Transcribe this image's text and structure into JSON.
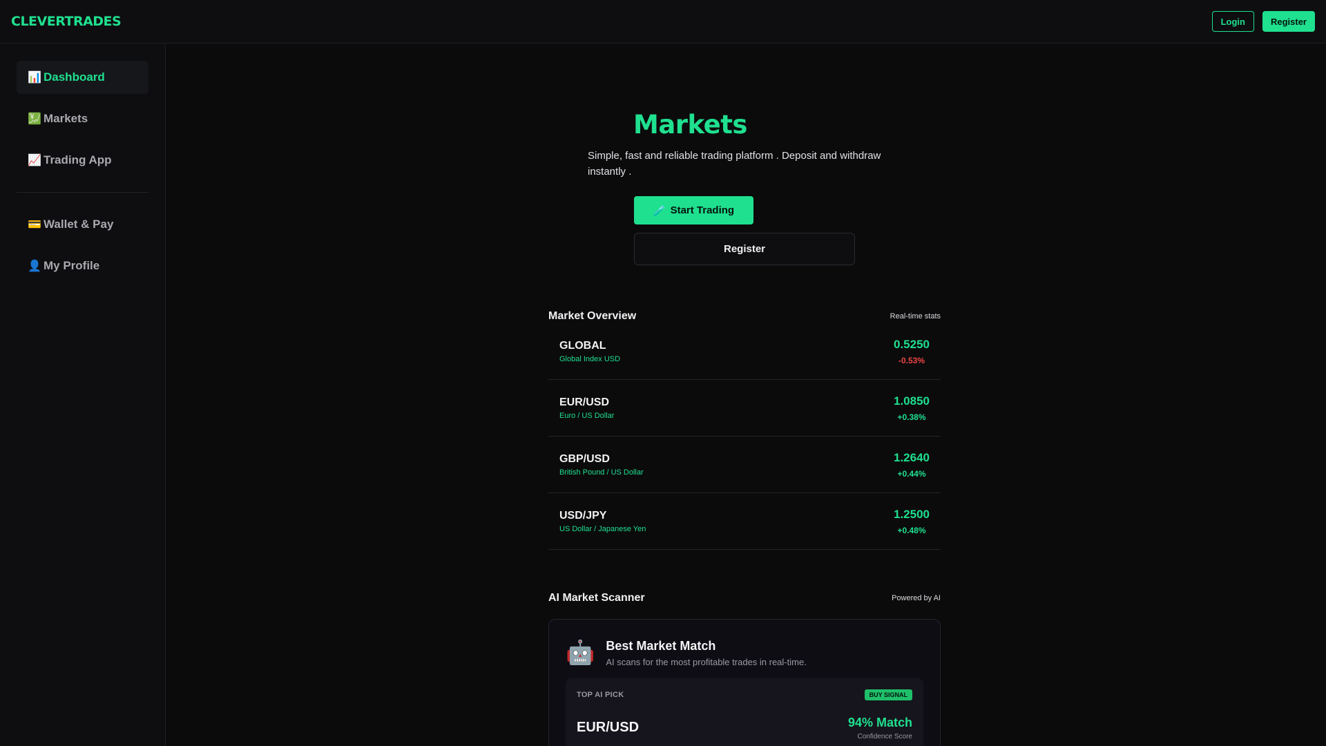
{
  "brand": "CLEVERTRADES",
  "header": {
    "login_label": "Login",
    "register_label": "Register"
  },
  "sidebar": {
    "items": [
      {
        "icon": "📊",
        "label": "Dashboard"
      },
      {
        "icon": "💹",
        "label": "Markets"
      },
      {
        "icon": "📈",
        "label": "Trading App"
      },
      {
        "icon": "💳",
        "label": "Wallet & Pay"
      },
      {
        "icon": "👤",
        "label": "My Profile"
      }
    ]
  },
  "hero": {
    "title": "Markets",
    "subtitle": "Simple, fast and reliable trading platform . Deposit and withdraw instantly .",
    "start_icon": "🧪",
    "start_label": "Start Trading",
    "register_label": "Register"
  },
  "market_overview": {
    "title": "Market Overview",
    "note": "Real-time stats",
    "rows": [
      {
        "symbol": "GLOBAL",
        "name": "Global Index USD",
        "price": "0.5250",
        "change": "-0.53%"
      },
      {
        "symbol": "EUR/USD",
        "name": "Euro / US Dollar",
        "price": "1.0850",
        "change": "+0.38%"
      },
      {
        "symbol": "GBP/USD",
        "name": "British Pound / US Dollar",
        "price": "1.2640",
        "change": "+0.44%"
      },
      {
        "symbol": "USD/JPY",
        "name": "US Dollar / Japanese Yen",
        "price": "1.2500",
        "change": "+0.48%"
      }
    ]
  },
  "ai_scanner": {
    "title": "AI Market Scanner",
    "note": "Powered by AI",
    "card_icon": "🤖",
    "card_title": "Best Market Match",
    "card_desc": "AI scans for the most profitable trades in real-time.",
    "pick_label": "TOP AI PICK",
    "signal": "BUY SIGNAL",
    "pair": "EUR/USD",
    "match": "94% Match",
    "confidence_label": "Confidence Score"
  },
  "colors": {
    "accent": "#1fe08f",
    "negative": "#ef4444",
    "background": "#0b0b0c"
  }
}
